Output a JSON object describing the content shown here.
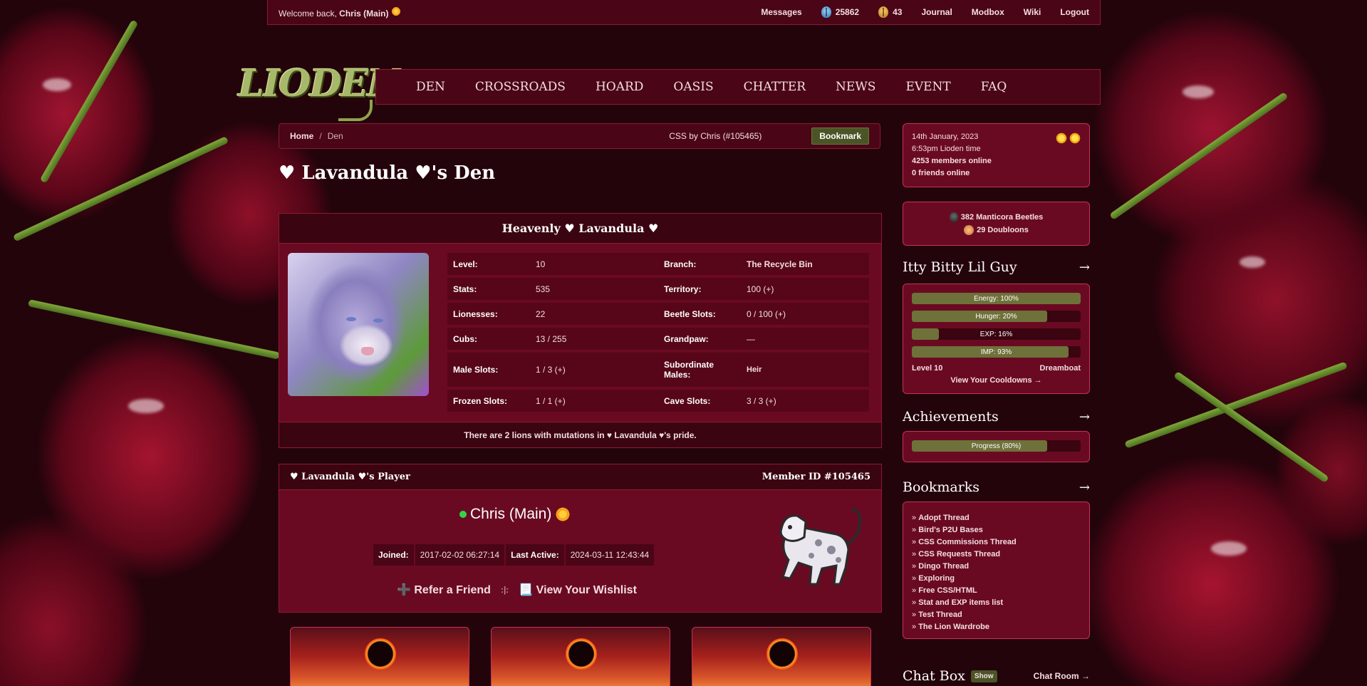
{
  "topbar": {
    "welcome_prefix": "Welcome back,",
    "user": "Chris (Main)",
    "messages": "Messages",
    "beetles": "25862",
    "gold": "43",
    "journal": "Journal",
    "modbox": "Modbox",
    "wiki": "Wiki",
    "logout": "Logout"
  },
  "logo": {
    "text": "LIODEN"
  },
  "nav": [
    "DEN",
    "CROSSROADS",
    "HOARD",
    "OASIS",
    "CHATTER",
    "NEWS",
    "EVENT",
    "FAQ"
  ],
  "breadcrumb": {
    "home": "Home",
    "sep": "/",
    "current": "Den",
    "css_credit": "CSS by Chris (#105465)",
    "bookmark": "Bookmark"
  },
  "page_title": "♥ Lavandula ♥'s Den",
  "lion_card": {
    "name": "Heavenly ♥ Lavandula ♥",
    "stats_left": [
      {
        "label": "Level:",
        "value": "10"
      },
      {
        "label": "Stats:",
        "value": "535"
      },
      {
        "label": "Lionesses:",
        "value": "22"
      },
      {
        "label": "Cubs:",
        "value": "13 / 255"
      },
      {
        "label": "Male Slots:",
        "value": "1 / 3 (+)"
      },
      {
        "label": "Frozen Slots:",
        "value": "1 / 1 (+)"
      }
    ],
    "stats_right": [
      {
        "label": "Branch:",
        "value": "The Recycle Bin"
      },
      {
        "label": "Territory:",
        "value": "100 (+)"
      },
      {
        "label": "Beetle Slots:",
        "value": "0 / 100 (+)"
      },
      {
        "label": "Grandpaw:",
        "value": "—"
      },
      {
        "label": "Subordinate Males:",
        "value": "Heir"
      },
      {
        "label": "Cave Slots:",
        "value": "3 / 3 (+)"
      }
    ],
    "footer": "There are 2 lions with mutations in ♥ Lavandula ♥'s pride."
  },
  "player": {
    "title": "♥ Lavandula ♥'s Player",
    "member_id": "Member ID #105465",
    "name": "Chris (Main)",
    "joined_label": "Joined:",
    "joined": "2017-02-02 06:27:14",
    "active_label": "Last Active:",
    "active": "2024-03-11 12:43:44",
    "refer": "➕ Refer a Friend",
    "wishlist": "📃 View Your Wishlist",
    "divider": ":|:"
  },
  "sidebar": {
    "date": "14th January, 2023",
    "time": "6:53pm Lioden time",
    "members_online": "4253 members online",
    "friends_online": "0 friends online",
    "beetles": "382 Manticora Beetles",
    "doubloons": "29 Doubloons",
    "pet_title": "Itty Bitty Lil Guy",
    "bars": [
      {
        "label": "Energy: 100%",
        "value": 100
      },
      {
        "label": "Hunger: 20%",
        "value": 80
      },
      {
        "label": "EXP: 16%",
        "value": 16
      },
      {
        "label": "IMP: 93%",
        "value": 93
      }
    ],
    "level": "Level 10",
    "mood": "Dreamboat",
    "cooldowns": "View Your Cooldowns →",
    "achievements_title": "Achievements",
    "progress_label": "Progress (80%)",
    "progress_value": 80,
    "bookmarks_title": "Bookmarks",
    "bookmarks": [
      "Adopt Thread",
      "Bird's P2U Bases",
      "CSS Commissions Thread",
      "CSS Requests Thread",
      "Dingo Thread",
      "Exploring",
      "Free CSS/HTML",
      "Stat and EXP items list",
      "Test Thread",
      "The Lion Wardrobe"
    ],
    "chat_title": "Chat Box",
    "chat_show": "Show",
    "chat_room": "Chat Room →",
    "arrow": "→"
  }
}
